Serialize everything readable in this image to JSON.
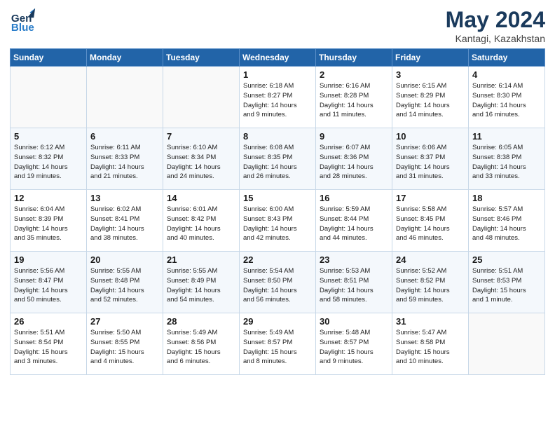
{
  "header": {
    "logo_general": "General",
    "logo_blue": "Blue",
    "month_year": "May 2024",
    "location": "Kantagi, Kazakhstan"
  },
  "days_of_week": [
    "Sunday",
    "Monday",
    "Tuesday",
    "Wednesday",
    "Thursday",
    "Friday",
    "Saturday"
  ],
  "weeks": [
    [
      {
        "day": "",
        "content": ""
      },
      {
        "day": "",
        "content": ""
      },
      {
        "day": "",
        "content": ""
      },
      {
        "day": "1",
        "content": "Sunrise: 6:18 AM\nSunset: 8:27 PM\nDaylight: 14 hours\nand 9 minutes."
      },
      {
        "day": "2",
        "content": "Sunrise: 6:16 AM\nSunset: 8:28 PM\nDaylight: 14 hours\nand 11 minutes."
      },
      {
        "day": "3",
        "content": "Sunrise: 6:15 AM\nSunset: 8:29 PM\nDaylight: 14 hours\nand 14 minutes."
      },
      {
        "day": "4",
        "content": "Sunrise: 6:14 AM\nSunset: 8:30 PM\nDaylight: 14 hours\nand 16 minutes."
      }
    ],
    [
      {
        "day": "5",
        "content": "Sunrise: 6:12 AM\nSunset: 8:32 PM\nDaylight: 14 hours\nand 19 minutes."
      },
      {
        "day": "6",
        "content": "Sunrise: 6:11 AM\nSunset: 8:33 PM\nDaylight: 14 hours\nand 21 minutes."
      },
      {
        "day": "7",
        "content": "Sunrise: 6:10 AM\nSunset: 8:34 PM\nDaylight: 14 hours\nand 24 minutes."
      },
      {
        "day": "8",
        "content": "Sunrise: 6:08 AM\nSunset: 8:35 PM\nDaylight: 14 hours\nand 26 minutes."
      },
      {
        "day": "9",
        "content": "Sunrise: 6:07 AM\nSunset: 8:36 PM\nDaylight: 14 hours\nand 28 minutes."
      },
      {
        "day": "10",
        "content": "Sunrise: 6:06 AM\nSunset: 8:37 PM\nDaylight: 14 hours\nand 31 minutes."
      },
      {
        "day": "11",
        "content": "Sunrise: 6:05 AM\nSunset: 8:38 PM\nDaylight: 14 hours\nand 33 minutes."
      }
    ],
    [
      {
        "day": "12",
        "content": "Sunrise: 6:04 AM\nSunset: 8:39 PM\nDaylight: 14 hours\nand 35 minutes."
      },
      {
        "day": "13",
        "content": "Sunrise: 6:02 AM\nSunset: 8:41 PM\nDaylight: 14 hours\nand 38 minutes."
      },
      {
        "day": "14",
        "content": "Sunrise: 6:01 AM\nSunset: 8:42 PM\nDaylight: 14 hours\nand 40 minutes."
      },
      {
        "day": "15",
        "content": "Sunrise: 6:00 AM\nSunset: 8:43 PM\nDaylight: 14 hours\nand 42 minutes."
      },
      {
        "day": "16",
        "content": "Sunrise: 5:59 AM\nSunset: 8:44 PM\nDaylight: 14 hours\nand 44 minutes."
      },
      {
        "day": "17",
        "content": "Sunrise: 5:58 AM\nSunset: 8:45 PM\nDaylight: 14 hours\nand 46 minutes."
      },
      {
        "day": "18",
        "content": "Sunrise: 5:57 AM\nSunset: 8:46 PM\nDaylight: 14 hours\nand 48 minutes."
      }
    ],
    [
      {
        "day": "19",
        "content": "Sunrise: 5:56 AM\nSunset: 8:47 PM\nDaylight: 14 hours\nand 50 minutes."
      },
      {
        "day": "20",
        "content": "Sunrise: 5:55 AM\nSunset: 8:48 PM\nDaylight: 14 hours\nand 52 minutes."
      },
      {
        "day": "21",
        "content": "Sunrise: 5:55 AM\nSunset: 8:49 PM\nDaylight: 14 hours\nand 54 minutes."
      },
      {
        "day": "22",
        "content": "Sunrise: 5:54 AM\nSunset: 8:50 PM\nDaylight: 14 hours\nand 56 minutes."
      },
      {
        "day": "23",
        "content": "Sunrise: 5:53 AM\nSunset: 8:51 PM\nDaylight: 14 hours\nand 58 minutes."
      },
      {
        "day": "24",
        "content": "Sunrise: 5:52 AM\nSunset: 8:52 PM\nDaylight: 14 hours\nand 59 minutes."
      },
      {
        "day": "25",
        "content": "Sunrise: 5:51 AM\nSunset: 8:53 PM\nDaylight: 15 hours\nand 1 minute."
      }
    ],
    [
      {
        "day": "26",
        "content": "Sunrise: 5:51 AM\nSunset: 8:54 PM\nDaylight: 15 hours\nand 3 minutes."
      },
      {
        "day": "27",
        "content": "Sunrise: 5:50 AM\nSunset: 8:55 PM\nDaylight: 15 hours\nand 4 minutes."
      },
      {
        "day": "28",
        "content": "Sunrise: 5:49 AM\nSunset: 8:56 PM\nDaylight: 15 hours\nand 6 minutes."
      },
      {
        "day": "29",
        "content": "Sunrise: 5:49 AM\nSunset: 8:57 PM\nDaylight: 15 hours\nand 8 minutes."
      },
      {
        "day": "30",
        "content": "Sunrise: 5:48 AM\nSunset: 8:57 PM\nDaylight: 15 hours\nand 9 minutes."
      },
      {
        "day": "31",
        "content": "Sunrise: 5:47 AM\nSunset: 8:58 PM\nDaylight: 15 hours\nand 10 minutes."
      },
      {
        "day": "",
        "content": ""
      }
    ]
  ]
}
